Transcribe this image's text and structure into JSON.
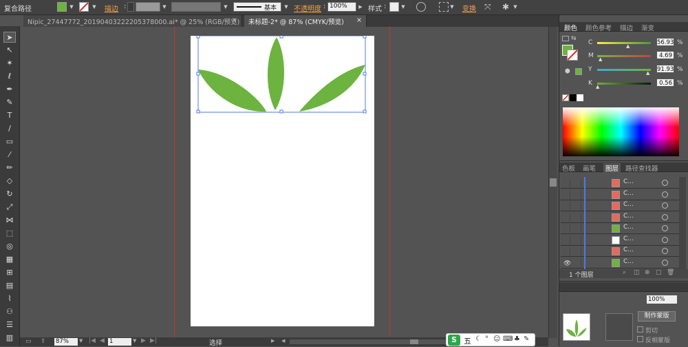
{
  "control_bar": {
    "object_type": "复合路径",
    "stroke_label": "描边",
    "stroke_weight": "",
    "brush_name": "基本",
    "opacity_label": "不透明度",
    "opacity_value": "100%",
    "style_label": "样式",
    "transform_label": "变换",
    "fill_color": "#6db33f"
  },
  "tabs": [
    {
      "label": "Nipic_27447772_20190403222205378000.ai* @ 25% (RGB/预览)"
    },
    {
      "label": "未标题-2* @ 87% (CMYK/预览)"
    }
  ],
  "color_panel": {
    "tabs": [
      "颜色",
      "颜色参考",
      "描边",
      "渐变"
    ],
    "channels": [
      {
        "label": "C",
        "value": "56.93",
        "pct": 0.57
      },
      {
        "label": "M",
        "value": "4.69",
        "pct": 0.05
      },
      {
        "label": "Y",
        "value": "91.93",
        "pct": 0.92
      },
      {
        "label": "K",
        "value": "0.56",
        "pct": 0.01
      }
    ],
    "unit": "%",
    "fill_color": "#6db33f"
  },
  "layers_panel": {
    "tabs": [
      "色板",
      "画笔",
      "图层",
      "路径查找器"
    ],
    "rows": [
      {
        "name": "C...",
        "thumb": "#e8685c"
      },
      {
        "name": "C...",
        "thumb": "#e8685c"
      },
      {
        "name": "C...",
        "thumb": "#e8685c"
      },
      {
        "name": "C...",
        "thumb": "#e8685c"
      },
      {
        "name": "C...",
        "thumb": "#6db33f"
      },
      {
        "name": "C...",
        "thumb": "#ffffff"
      },
      {
        "name": "C...",
        "thumb": "#e8685c"
      },
      {
        "name": "C...",
        "thumb": "#6db33f"
      }
    ],
    "layer_count": "1 个图层"
  },
  "lower_panel": {
    "opacity": "100%",
    "make_mask": "制作蒙版",
    "clip": "剪切",
    "invert_mask": "反相蒙版"
  },
  "status_bar": {
    "zoom": "87%",
    "page": "1",
    "tool": "选择"
  },
  "ime_bar": {
    "logo": "S",
    "mode": "五"
  }
}
